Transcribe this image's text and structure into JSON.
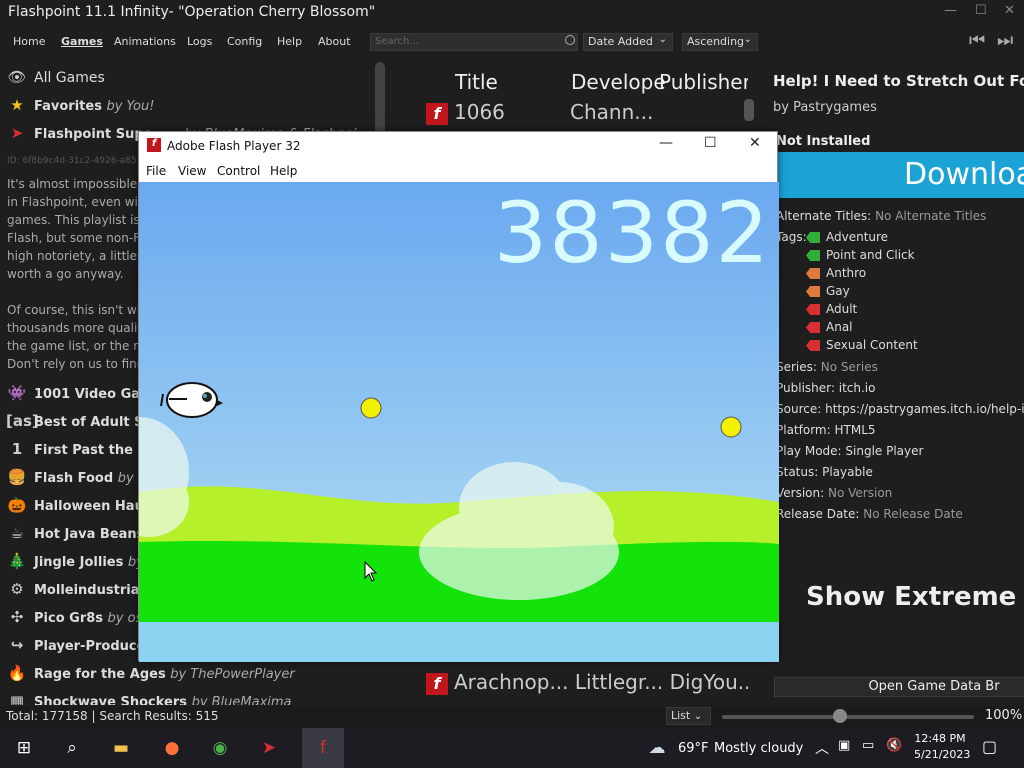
{
  "app": {
    "title": "Flashpoint 11.1 Infinity- \"Operation Cherry Blossom\"",
    "window_buttons": [
      "—",
      "☐",
      "✕"
    ]
  },
  "menu": [
    "Home",
    "Games",
    "Animations",
    "Logs",
    "Config",
    "Help",
    "About"
  ],
  "search": {
    "placeholder": "Search...",
    "value": ""
  },
  "sort": {
    "field": "Date Added",
    "order": "Ascending"
  },
  "sidebar": {
    "all_games": "All Games",
    "favorites": {
      "name": "Favorites",
      "by": "by You!"
    },
    "superhall": {
      "name": "Flashpoint Supe...",
      "by": "...by BlueMaxima & Flashpoi..."
    },
    "id": "ID: 6f8b9c4d-31c2-4926-a85",
    "description": [
      "It's almost impossible t",
      "in Flashpoint, even wit",
      "games. This playlist is a",
      "Flash, but some non-Fl",
      "high notoriety, a little b",
      "worth a go anyway.",
      "",
      "Of course, this isn't wh",
      "thousands more qualit",
      "the game list, or the ra",
      "Don't rely on us to find"
    ],
    "playlists": [
      {
        "name": "1001 Video Gar",
        "by": "",
        "icon": "👾"
      },
      {
        "name": "Best of Adult Sv",
        "by": "",
        "icon": "[as]"
      },
      {
        "name": "First Past the Po",
        "by": "",
        "icon": "1"
      },
      {
        "name": "Flash Food",
        "by": "by Th",
        "icon": "🍔"
      },
      {
        "name": "Halloween Hau",
        "by": "",
        "icon": "🎃"
      },
      {
        "name": "Hot Java Beans",
        "by": "",
        "icon": "☕"
      },
      {
        "name": "Jingle Jollies",
        "by": "by",
        "icon": "🎄"
      },
      {
        "name": "Molleindustria'",
        "by": "",
        "icon": "⚙"
      },
      {
        "name": "Pico Gr8s",
        "by": "by osh",
        "icon": "✣"
      },
      {
        "name": "Player-Produce",
        "by": "",
        "icon": "↪"
      },
      {
        "name": "Rage for the Ages",
        "by": "by ThePowerPlayer",
        "icon": "🔥"
      },
      {
        "name": "Shockwave Shockers",
        "by": "by BlueMaxima",
        "icon": "▦"
      }
    ]
  },
  "game_list": {
    "headers": [
      "Title",
      "Develope",
      "Publisher"
    ],
    "rows": [
      {
        "title": "1066",
        "developer": "Chann...",
        "publisher": ""
      },
      {
        "title": "Arachnop...",
        "developer": "Littlegr...",
        "publisher": "DigYou..."
      }
    ]
  },
  "detail": {
    "title": "Help! I Need to Stretch Out For Va",
    "by": "by Pastrygames",
    "status": "Not Installed",
    "download": "Download",
    "alt_titles_label": "Alternate Titles:",
    "alt_titles_value": "No Alternate Titles",
    "tags_label": "Tags:",
    "tags": [
      {
        "name": "Adventure",
        "color": "#2fae3a"
      },
      {
        "name": "Point and Click",
        "color": "#2fae3a"
      },
      {
        "name": "Anthro",
        "color": "#e07a3c"
      },
      {
        "name": "Gay",
        "color": "#e07a3c"
      },
      {
        "name": "Adult",
        "color": "#d83030"
      },
      {
        "name": "Anal",
        "color": "#d83030"
      },
      {
        "name": "Sexual Content",
        "color": "#d83030"
      }
    ],
    "series_label": "Series:",
    "series_value": "No Series",
    "publisher_label": "Publisher:",
    "publisher_value": "itch.io",
    "source_label": "Source:",
    "source_value": "https://pastrygames.itch.io/help-i-n",
    "platform_label": "Platform:",
    "platform_value": "HTML5",
    "playmode_label": "Play Mode:",
    "playmode_value": "Single Player",
    "status_label": "Status:",
    "status_value": "Playable",
    "version_label": "Version:",
    "version_value": "No Version",
    "release_label": "Release Date:",
    "release_value": "No Release Date",
    "extreme": "Show Extreme Sc",
    "open_data": "Open Game Data Br"
  },
  "statusbar": {
    "total": "Total: 177158  |  Search Results: 515",
    "view": "List",
    "zoom_percent": "100%",
    "zoom_value": 0.47
  },
  "flash": {
    "title": "Adobe Flash Player 32",
    "menu": [
      "File",
      "View",
      "Control",
      "Help"
    ],
    "score": "38382"
  },
  "taskbar": {
    "weather_temp": "69°F",
    "weather_text": "Mostly cloudy",
    "time": "12:48 PM",
    "date": "5/21/2023"
  }
}
